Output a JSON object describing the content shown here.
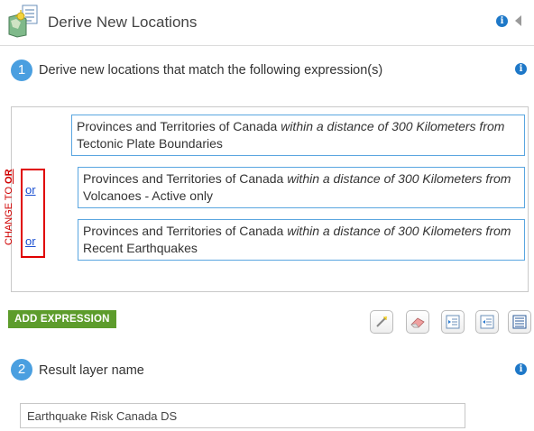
{
  "header": {
    "title": "Derive New Locations",
    "info_icon": "i"
  },
  "step1": {
    "number": "1",
    "label": "Derive new locations that match the following expression(s)",
    "info_icon": "i"
  },
  "expressions": [
    {
      "layer": "Provinces and Territories of Canada",
      "relation": "within a distance of 300 Kilometers from",
      "target": "Tectonic Plate Boundaries"
    },
    {
      "layer": "Provinces and Territories of Canada",
      "relation": "within a distance of 300 Kilometers from",
      "target": "Volcanoes - Active only"
    },
    {
      "layer": "Provinces and Territories of Canada",
      "relation": "within a distance of 300 Kilometers from",
      "target": "Recent Earthquakes"
    }
  ],
  "operators": [
    "or",
    "or"
  ],
  "annotation": {
    "text": "CHANGE TO ",
    "emphasis": "OR",
    "color": "#e00000"
  },
  "add_expression_label": "ADD EXPRESSION",
  "toolbar_icons": [
    "edit-icon",
    "eraser-icon",
    "indent-icon",
    "outdent-icon",
    "list-icon"
  ],
  "step2": {
    "number": "2",
    "label": "Result layer name",
    "info_icon": "i"
  },
  "result_layer_name": "Earthquake Risk Canada DS",
  "colors": {
    "accent": "#4a9fe0",
    "info": "#1e78c8",
    "add_button": "#5d9c2c",
    "row_border": "#5aa6e0"
  }
}
